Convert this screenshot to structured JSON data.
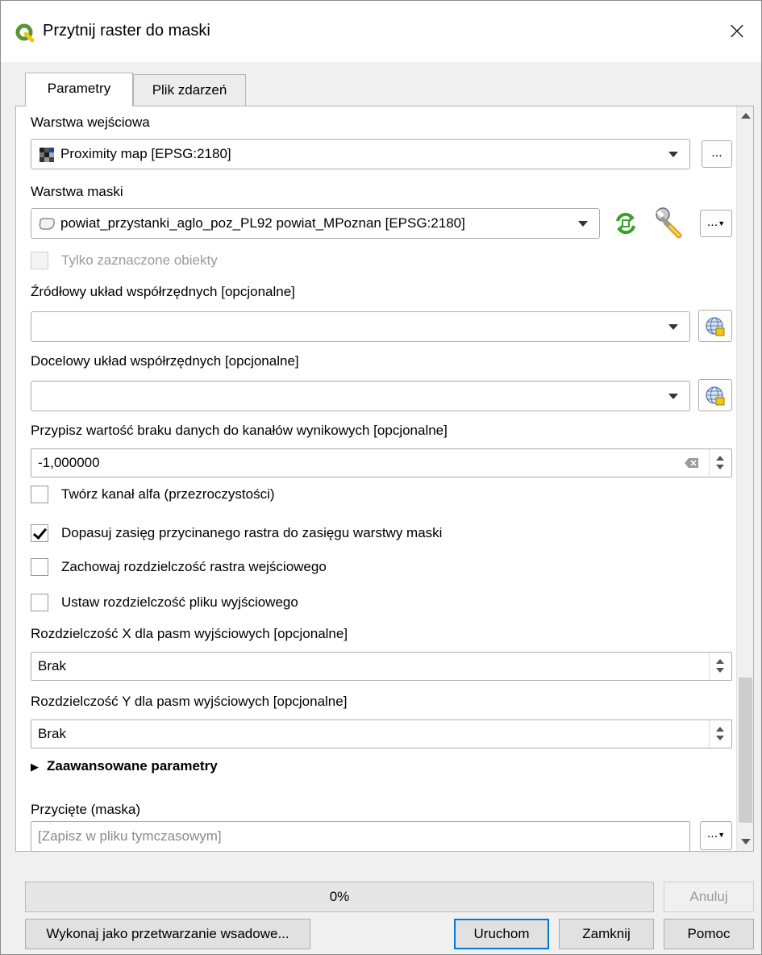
{
  "window": {
    "title": "Przytnij raster do maski",
    "close_glyph": "×"
  },
  "tabs": [
    {
      "label": "Parametry",
      "active": true
    },
    {
      "label": "Plik zdarzeń",
      "active": false
    }
  ],
  "params": {
    "input_layer": {
      "label": "Warstwa wejściowa",
      "value": "Proximity map [EPSG:2180]",
      "icon": "raster-layer-icon",
      "browse_label": "..."
    },
    "mask_layer": {
      "label": "Warstwa maski",
      "value": "powiat_przystanki_aglo_poz_PL92 powiat_MPoznan [EPSG:2180]",
      "icon": "polygon-layer-icon",
      "browse_label": "..."
    },
    "selected_only": {
      "label": "Tylko zaznaczone obiekty",
      "checked": false,
      "enabled": false
    },
    "source_crs": {
      "label": "Źródłowy układ współrzędnych [opcjonalne]",
      "value": ""
    },
    "target_crs": {
      "label": "Docelowy układ współrzędnych [opcjonalne]",
      "value": ""
    },
    "nodata": {
      "label": "Przypisz wartość braku danych do kanałów wynikowych [opcjonalne]",
      "value": "-1,000000"
    },
    "alpha_band": {
      "label": "Twórz kanał alfa (przezroczystości)",
      "checked": false
    },
    "crop_to_cutline": {
      "label": "Dopasuj zasięg przycinanego rastra do zasięgu warstwy maski",
      "checked": true
    },
    "keep_resolution": {
      "label": "Zachowaj rozdzielczość rastra wejściowego",
      "checked": false
    },
    "set_resolution": {
      "label": "Ustaw rozdzielczość pliku wyjściowego",
      "checked": false
    },
    "x_resolution": {
      "label": "Rozdzielczość X dla pasm wyjściowych [opcjonalne]",
      "value": "Brak"
    },
    "y_resolution": {
      "label": "Rozdzielczość Y dla pasm wyjściowych [opcjonalne]",
      "value": "Brak"
    },
    "advanced": {
      "label": "Zaawansowane parametry",
      "expanded": false
    },
    "output": {
      "label": "Przycięte (maska)",
      "placeholder": "[Zapisz w pliku tymczasowym]",
      "browse_label": "..."
    }
  },
  "progress": {
    "value": 0,
    "label": "0%"
  },
  "buttons": {
    "cancel": "Anuluj",
    "batch": "Wykonaj jako przetwarzanie wsadowe...",
    "run": "Uruchom",
    "close": "Zamknij",
    "help": "Pomoc"
  },
  "colors": {
    "accent": "#0078d7",
    "qgis_green": "#589632",
    "qgis_yellow": "#f0c419",
    "progress_fill": "#06b025"
  }
}
